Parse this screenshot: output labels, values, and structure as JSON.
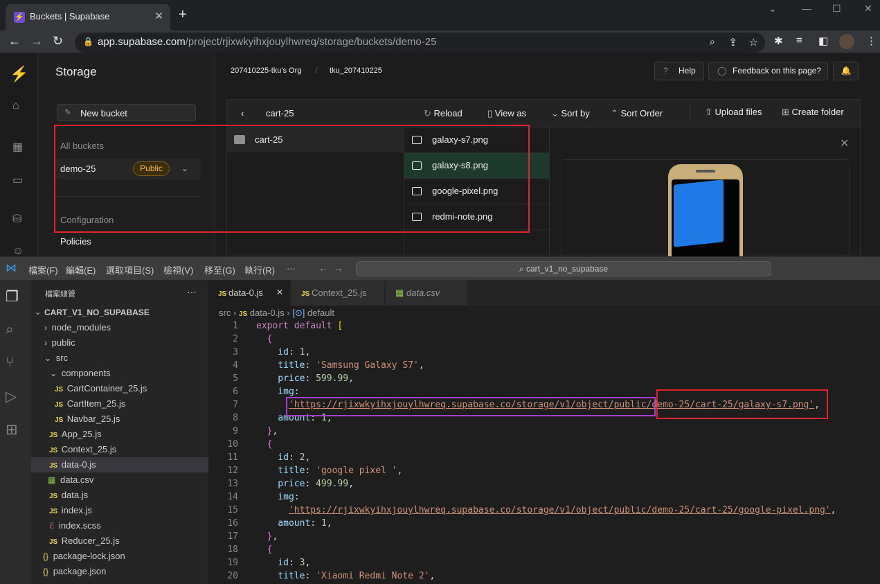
{
  "browser": {
    "tab_title": "Buckets | Supabase",
    "url_host": "app.supabase.com",
    "url_path": "/project/rjixwkyihxjouylhwreq/storage/buckets/demo-25"
  },
  "supabase": {
    "section_title": "Storage",
    "org": "207410225-tku's Org",
    "project": "tku_207410225",
    "help_label": "Help",
    "feedback_label": "Feedback on this page?",
    "new_bucket_label": "New bucket",
    "all_buckets_label": "All buckets",
    "bucket": {
      "name": "demo-25",
      "badge": "Public"
    },
    "configuration_label": "Configuration",
    "policies_label": "Policies",
    "explorer": {
      "current_folder": "cart-25",
      "reload": "Reload",
      "view_as": "View as",
      "sort_by": "Sort by",
      "sort_order": "Sort Order",
      "upload": "Upload files",
      "create_folder": "Create folder",
      "folders": [
        "cart-25"
      ],
      "files": [
        "galaxy-s7.png",
        "galaxy-s8.png",
        "google-pixel.png",
        "redmi-note.png"
      ],
      "selected_file": "galaxy-s8.png"
    }
  },
  "vscode": {
    "menus": [
      "檔案(F)",
      "編輯(E)",
      "選取項目(S)",
      "檢視(V)",
      "移至(G)",
      "執行(R)",
      "···"
    ],
    "search_placeholder": "cart_v1_no_supabase",
    "explorer_title": "檔案總管",
    "project": "CART_V1_NO_SUPABASE",
    "tree": [
      "node_modules",
      "public",
      "src",
      "components",
      "CartContainer_25.js",
      "CartItem_25.js",
      "Navbar_25.js",
      "App_25.js",
      "Context_25.js",
      "data-0.js",
      "data.csv",
      "data.js",
      "index.js",
      "index.scss",
      "Reducer_25.js",
      "package-lock.json",
      "package.json"
    ],
    "tabs": [
      "data-0.js",
      "Context_25.js",
      "data.csv"
    ],
    "breadcrumb": {
      "a": "src",
      "b": "data-0.js",
      "c": "default"
    },
    "line_numbers": [
      "1",
      "2",
      "3",
      "4",
      "5",
      "6",
      "7",
      "8",
      "9",
      "10",
      "11",
      "12",
      "13",
      "14",
      "15",
      "16",
      "17",
      "18",
      "19",
      "20"
    ],
    "code": {
      "export": "export default",
      "id1": "1",
      "title1": "'Samsung Galaxy S7'",
      "price1": "599.99",
      "url1a": "'https://rjixwkyihxjouylhwreq.supabase.co/storage/v1/object/public/",
      "url1b": "demo-25/cart-25/galaxy-s7.png'",
      "amount1": "1",
      "id2": "2",
      "title2": "'google pixel '",
      "price2": "499.99",
      "url2": "'https://rjixwkyihxjouylhwreq.supabase.co/storage/v1/object/public/demo-25/cart-25/google-pixel.png'",
      "amount2": "1",
      "id3": "3",
      "title3": "'Xiaomi Redmi Note 2'"
    }
  }
}
